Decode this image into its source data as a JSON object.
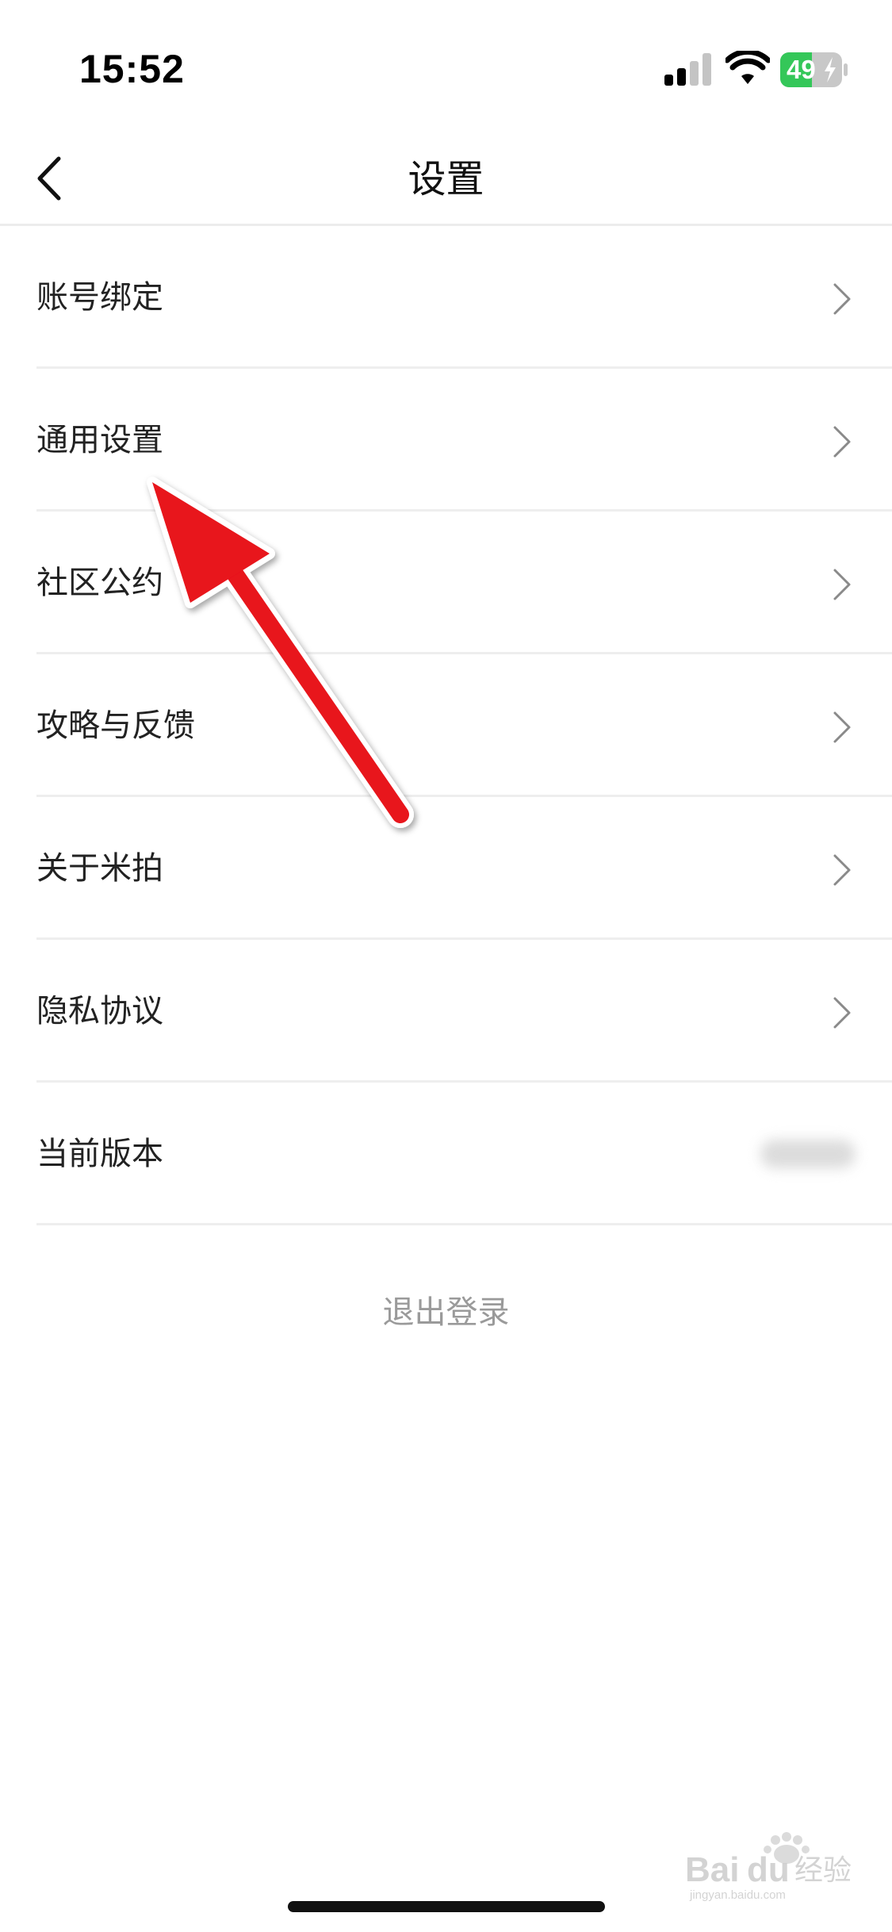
{
  "status_bar": {
    "time": "15:52",
    "battery": "49",
    "icons": [
      "signal-icon",
      "wifi-icon",
      "battery-icon"
    ],
    "battery_color": "#34c759"
  },
  "nav": {
    "title": "设置",
    "back_icon": "chevron-left-icon"
  },
  "settings": {
    "items": [
      {
        "label": "账号绑定",
        "icon": "chevron-right-icon"
      },
      {
        "label": "通用设置",
        "icon": "chevron-right-icon"
      },
      {
        "label": "社区公约",
        "icon": "chevron-right-icon"
      },
      {
        "label": "攻略与反馈",
        "icon": "chevron-right-icon"
      },
      {
        "label": "关于米拍",
        "icon": "chevron-right-icon"
      },
      {
        "label": "隐私协议",
        "icon": "chevron-right-icon"
      },
      {
        "label": "当前版本"
      }
    ]
  },
  "logout": {
    "label": "退出登录"
  },
  "annotation": {
    "arrow_color": "#e8121b",
    "target": "通用设置"
  },
  "watermark": {
    "text": "Baidu经验",
    "subtext": "jingyan.baidu.com"
  }
}
